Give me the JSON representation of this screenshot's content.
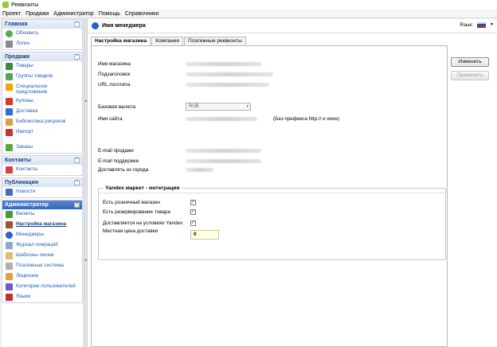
{
  "window": {
    "title": "Реквизиты"
  },
  "menu": [
    "Проект",
    "Продажи",
    "Администратор",
    "Помощь",
    "Справочники"
  ],
  "sidebar": {
    "groups": [
      {
        "title": "Главная",
        "items": [
          "Обновить",
          "Логин"
        ]
      },
      {
        "title": "Продажи",
        "items": [
          "Товары",
          "Группы товаров",
          "Специальное предложение",
          "Купоны",
          "Доставка",
          "Библиотека рисунков",
          "Импорт",
          "Заказы"
        ]
      },
      {
        "title": "Контакты",
        "items": [
          "Контакты"
        ]
      },
      {
        "title": "Публикации",
        "items": [
          "Новости"
        ]
      },
      {
        "title": "Администратор",
        "items": [
          "Валюты",
          "Настройка магазина",
          "Менеджеры",
          "Журнал операций",
          "Шаблоны писем",
          "Платежные системы",
          "Лицензии",
          "Категории пользователей",
          "Языки"
        ]
      }
    ]
  },
  "header": {
    "manager": "Имя менеджера",
    "lang_label": "Язык:"
  },
  "tabs": [
    "Настройка магазина",
    "Компания",
    "Платежные реквизиты"
  ],
  "form": {
    "shop_name": "Имя магазина",
    "subtitle": "Подзаголовок",
    "logo_url": "URL логотипа",
    "base_currency": "Базовая валюта",
    "currency_value": "RUB",
    "site_name": "Имя сайта",
    "site_note": "(Без префикса http:// и www)",
    "email_sales": "E-mail продажи",
    "email_support": "E-mail поддержки",
    "ship_from": "Доставлять из города"
  },
  "yandex": {
    "title": "Yandex маркет - интеграция",
    "retail": "Есть розничный магазин",
    "reserve": "Есть резервирование товара",
    "delivered": "Доставляется на условиях Yandex",
    "local_price": "Местная цена доставки",
    "local_price_value": "0"
  },
  "buttons": {
    "change": "Изменить",
    "apply": "Применить"
  }
}
